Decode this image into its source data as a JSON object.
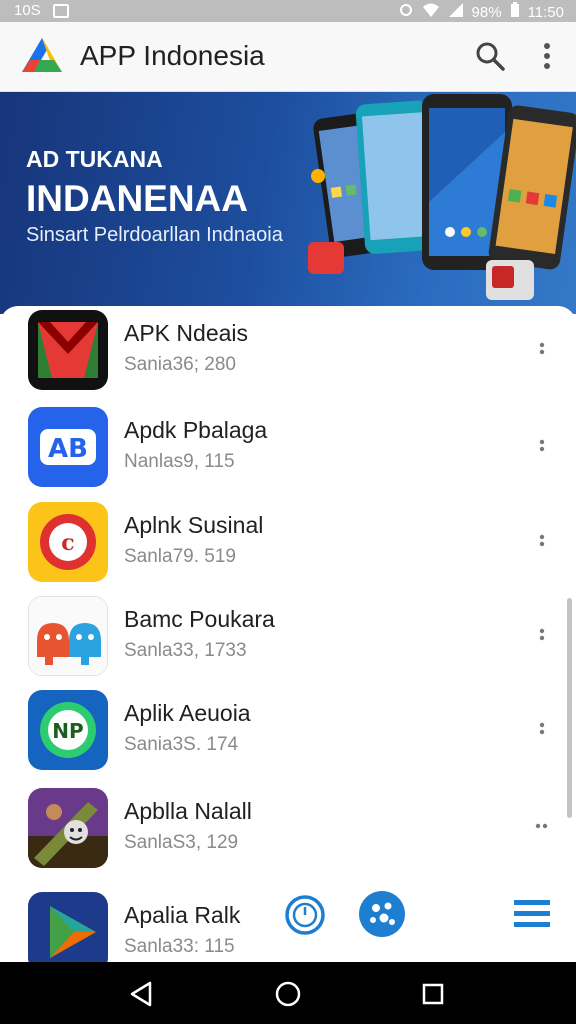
{
  "status_bar": {
    "time_left": "10S",
    "battery": "98%",
    "time_right": "11:50"
  },
  "app_bar": {
    "title": "APP Indonesia"
  },
  "banner": {
    "line1": "AD TUKANA",
    "line2": "INDANENAA",
    "line3": "Sinsart Pelrdoarllan Indnaoia"
  },
  "apps": [
    {
      "name": "APK Ndeais",
      "meta": "Sania36; 280",
      "icon": "red-envelope-icon"
    },
    {
      "name": "Apdk Pbalaga",
      "meta": "Nanlas9, 115",
      "icon": "blue-ab-icon"
    },
    {
      "name": "Aplnk Susinal",
      "meta": "Sanla79. 519",
      "icon": "yellow-c-icon"
    },
    {
      "name": "Bamc Poukara",
      "meta": "Sanla33, 1733",
      "icon": "android-robots-icon"
    },
    {
      "name": "Aplik Aeuoia",
      "meta": "Sania3S. 174",
      "icon": "np-recycle-icon"
    },
    {
      "name": "Apblla Nalall",
      "meta": "SanlaS3, 129",
      "icon": "game-character-icon"
    },
    {
      "name": "Apalia Ralk",
      "meta": "Sanla33: 115",
      "icon": "play-triangle-icon"
    }
  ],
  "colors": {
    "banner_dark": "#17357a",
    "banner_light": "#3478c7",
    "accent_blue": "#1e7fd0"
  }
}
